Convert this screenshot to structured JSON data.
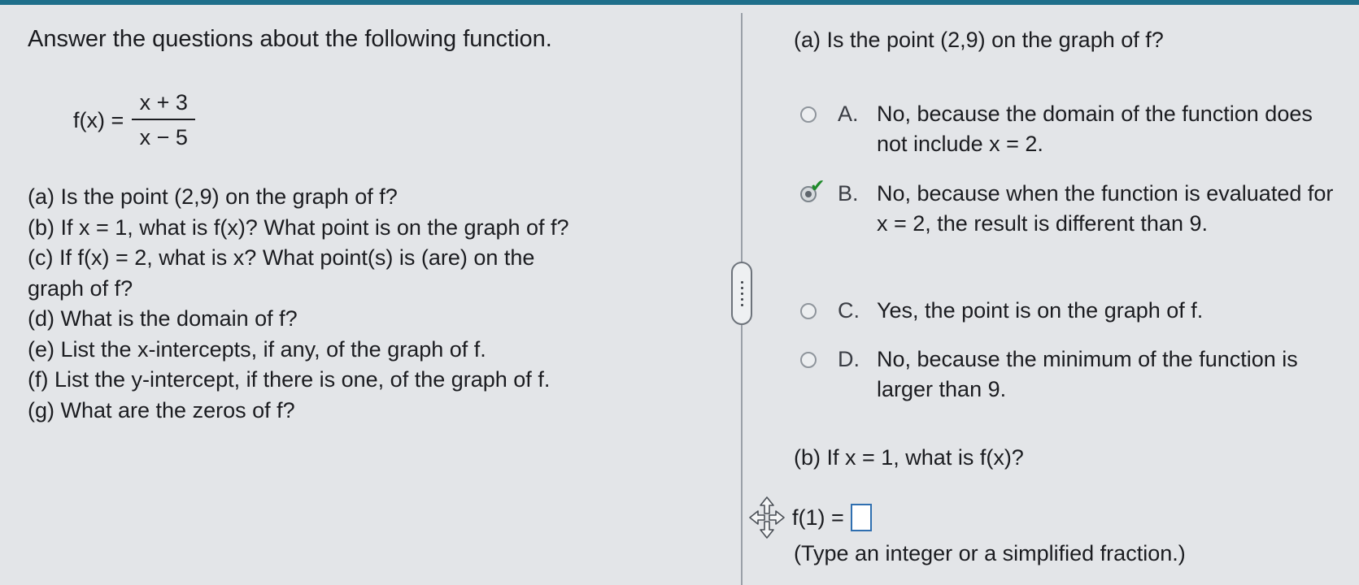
{
  "prompt": {
    "intro": "Answer the questions about the following function.",
    "function_lhs": "f(x) =",
    "numerator": "x + 3",
    "denominator": "x − 5"
  },
  "questions": [
    "(a)  Is the point (2,9) on the graph of f?",
    "(b)  If x = 1, what is f(x)? What point is on the graph of f?",
    "(c)  If f(x) = 2, what is x? What point(s) is (are) on the",
    "graph of f?",
    "(d)  What is the domain of f?",
    "(e)  List the x-intercepts, if any, of the graph of f.",
    "(f)  List the y-intercept, if there is one, of the graph of f.",
    "(g)  What are the zeros of f?"
  ],
  "part_a": {
    "title": "(a)  Is the point (2,9) on the graph of f?",
    "choices": [
      {
        "letter": "A.",
        "text": "No, because the domain of the function does not include x = 2.",
        "selected": false
      },
      {
        "letter": "B.",
        "text": "No, because when the function is evaluated for x = 2, the result is different than 9.",
        "selected": true
      },
      {
        "letter": "C.",
        "text": "Yes, the point is on the graph of f.",
        "selected": false
      },
      {
        "letter": "D.",
        "text": "No, because the minimum of the function is larger than 9.",
        "selected": false
      }
    ]
  },
  "part_b": {
    "title": "(b)  If x = 1, what is f(x)?",
    "answer_label": "f(1) =",
    "answer_value": "",
    "hint": "(Type an integer or a simplified fraction.)"
  },
  "icons": {
    "check": "check-icon",
    "move": "move-icon",
    "handle": "pane-resize-handle"
  },
  "colors": {
    "accent": "#1f6f8b",
    "check": "#1f8a2b",
    "input_border": "#2f6fb0"
  }
}
